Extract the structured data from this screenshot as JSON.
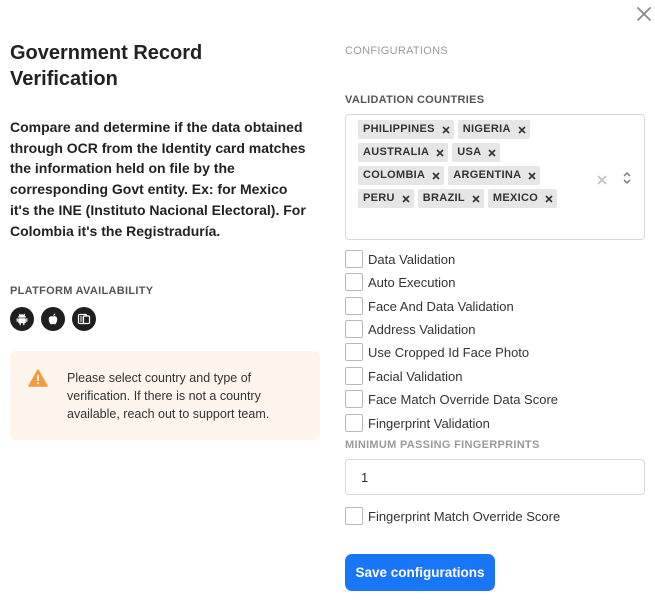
{
  "title": "Government Record Verification",
  "description": "Compare and determine if the data obtained through OCR from the Identity card matches the information held on file by the corresponding Govt entity. Ex: for Mexico it's the INE (Instituto Nacional Electoral). For Colombia it's the Registraduría.",
  "platform_availability": {
    "label": "PLATFORM AVAILABILITY",
    "platforms": [
      "android-icon",
      "apple-icon",
      "web-icon"
    ]
  },
  "alert": {
    "icon": "warning-icon",
    "color": "#f39b3a",
    "text": "Please select country and type of verification. If there is not a country available, reach out to support team."
  },
  "configurations_label": "CONFIGURATIONS",
  "validation_countries": {
    "label": "VALIDATION COUNTRIES",
    "selected": [
      "PHILIPPINES",
      "NIGERIA",
      "AUSTRALIA",
      "USA",
      "COLOMBIA",
      "ARGENTINA",
      "PERU",
      "BRAZIL",
      "MEXICO"
    ]
  },
  "options": [
    {
      "label": "Data Validation",
      "checked": false
    },
    {
      "label": "Auto Execution",
      "checked": false
    },
    {
      "label": "Face And Data Validation",
      "checked": false
    },
    {
      "label": "Address Validation",
      "checked": false
    },
    {
      "label": "Use Cropped Id Face Photo",
      "checked": false
    },
    {
      "label": "Facial Validation",
      "checked": false
    },
    {
      "label": "Face Match Override Data Score",
      "checked": false
    },
    {
      "label": "Fingerprint Validation",
      "checked": false
    }
  ],
  "min_fingerprints": {
    "label": "MINIMUM PASSING FINGERPRINTS",
    "value": "1"
  },
  "fingerprint_override": {
    "label": "Fingerprint Match Override Score",
    "checked": false
  },
  "save_label": "Save configurations",
  "colors": {
    "primary": "#1976f7",
    "alert_bg": "#fdf4ec"
  }
}
